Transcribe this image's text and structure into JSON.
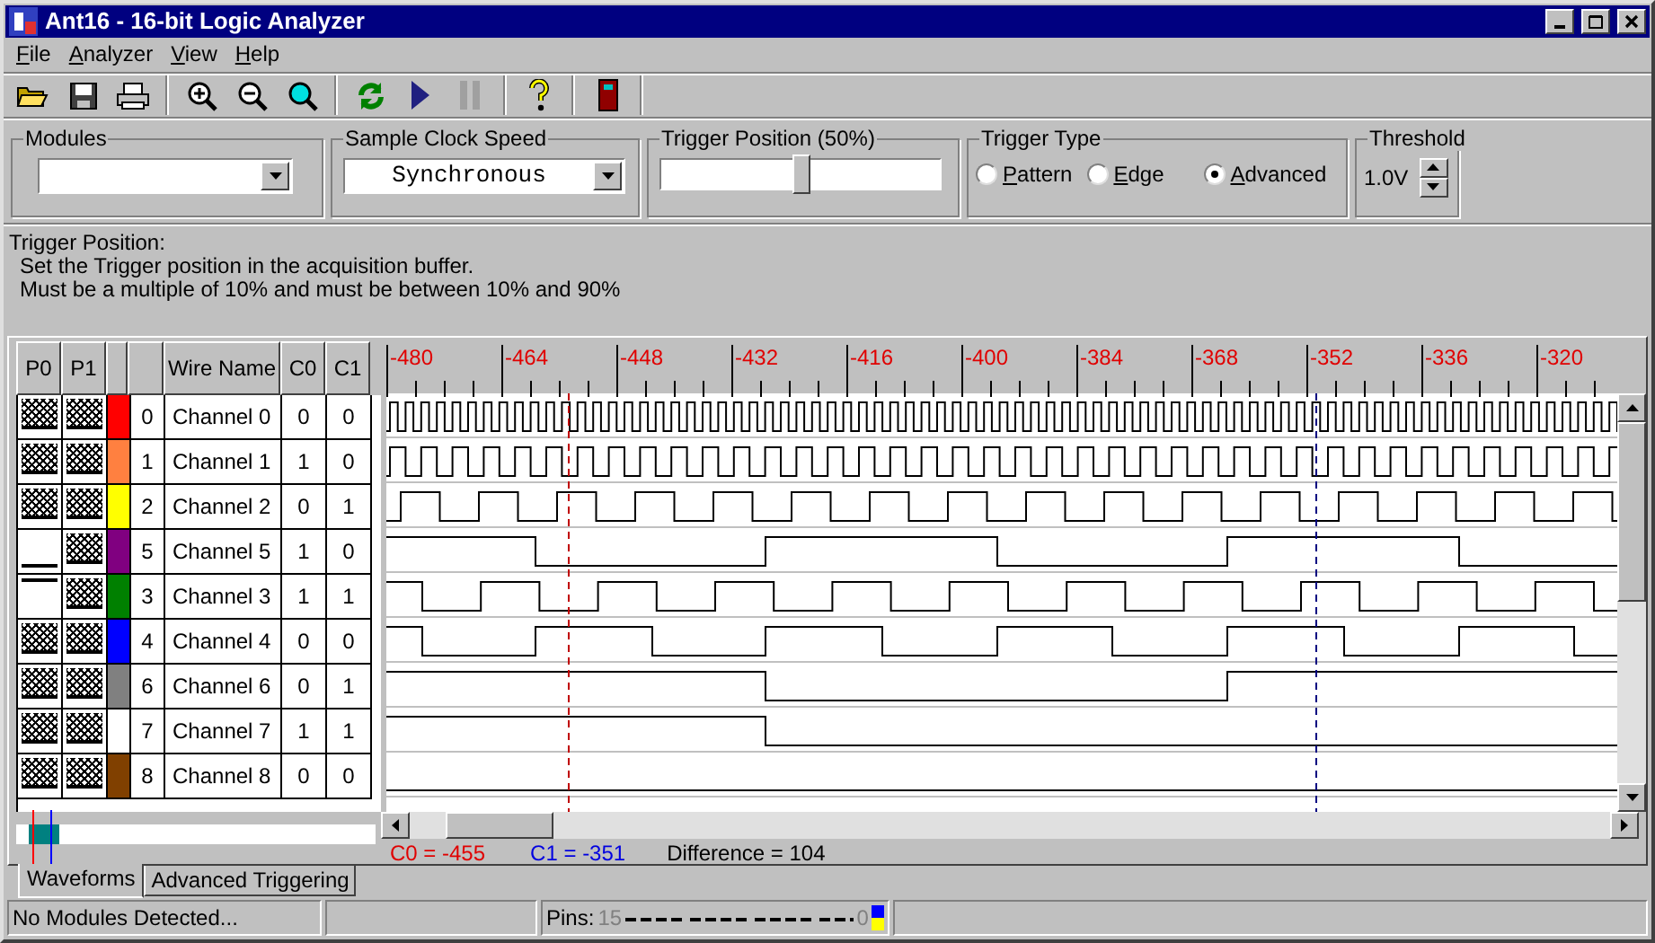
{
  "window": {
    "title": "Ant16 - 16-bit Logic Analyzer"
  },
  "menu": [
    {
      "label": "File"
    },
    {
      "label": "Analyzer"
    },
    {
      "label": "View"
    },
    {
      "label": "Help"
    }
  ],
  "controls": {
    "modules": {
      "label": "Modules"
    },
    "clock": {
      "label": "Sample Clock Speed",
      "value": "Synchronous"
    },
    "trigger_position": {
      "label": "Trigger Position (50%)",
      "level": 0.5
    },
    "trigger_type": {
      "label": "Trigger Type",
      "options": [
        {
          "label": "Pattern",
          "selected": false
        },
        {
          "label": "Edge",
          "selected": false
        },
        {
          "label": "Advanced",
          "selected": true
        }
      ]
    },
    "threshold": {
      "label": "Threshold",
      "value": "1.0V"
    }
  },
  "help": {
    "title": "Trigger Position:",
    "lines": [
      "Set the Trigger position in the acquisition buffer.",
      "Must be a multiple of 10% and must be between 10% and 90%"
    ]
  },
  "table": {
    "columns": [
      "P0",
      "P1",
      "Wire Name",
      "C0",
      "C1"
    ],
    "rows": [
      {
        "p0": {
          "kind": "any"
        },
        "p1": {
          "kind": "any"
        },
        "color": "#ff0000",
        "number": "0",
        "name": "Channel 0",
        "c0": "0",
        "c1": "0"
      },
      {
        "p0": {
          "kind": "any"
        },
        "p1": {
          "kind": "any"
        },
        "color": "#ff8040",
        "number": "1",
        "name": "Channel 1",
        "c0": "1",
        "c1": "0"
      },
      {
        "p0": {
          "kind": "any"
        },
        "p1": {
          "kind": "any"
        },
        "color": "#ffff00",
        "number": "2",
        "name": "Channel 2",
        "c0": "0",
        "c1": "1"
      },
      {
        "p0": {
          "kind": "low"
        },
        "p1": {
          "kind": "any"
        },
        "color": "#800080",
        "number": "5",
        "name": "Channel 5",
        "c0": "1",
        "c1": "0"
      },
      {
        "p0": {
          "kind": "high"
        },
        "p1": {
          "kind": "any"
        },
        "color": "#008000",
        "number": "3",
        "name": "Channel 3",
        "c0": "1",
        "c1": "1"
      },
      {
        "p0": {
          "kind": "any"
        },
        "p1": {
          "kind": "any"
        },
        "color": "#0000ff",
        "number": "4",
        "name": "Channel 4",
        "c0": "0",
        "c1": "0"
      },
      {
        "p0": {
          "kind": "any"
        },
        "p1": {
          "kind": "any"
        },
        "color": "#808080",
        "number": "6",
        "name": "Channel 6",
        "c0": "0",
        "c1": "1"
      },
      {
        "p0": {
          "kind": "any"
        },
        "p1": {
          "kind": "any"
        },
        "color": "#ffffff",
        "number": "7",
        "name": "Channel 7",
        "c0": "1",
        "c1": "1"
      },
      {
        "p0": {
          "kind": "any"
        },
        "p1": {
          "kind": "any"
        },
        "color": "#804000",
        "number": "8",
        "name": "Channel 8",
        "c0": "0",
        "c1": "0"
      }
    ]
  },
  "ruler": [
    "-480",
    "-464",
    "-448",
    "-432",
    "-416",
    "-400",
    "-384",
    "-368",
    "-352",
    "-336",
    "-320"
  ],
  "cursors": {
    "c0": "C0 = -455",
    "c1": "C1 = -351",
    "difference": "Difference = 104"
  },
  "tabs": [
    {
      "label": "Waveforms",
      "selected": true
    },
    {
      "label": "Advanced Triggering",
      "selected": false
    }
  ],
  "status_bar": {
    "message": "No Modules Detected...",
    "pins_label": "Pins:",
    "pins_high": "15",
    "pins_low": "0"
  }
}
